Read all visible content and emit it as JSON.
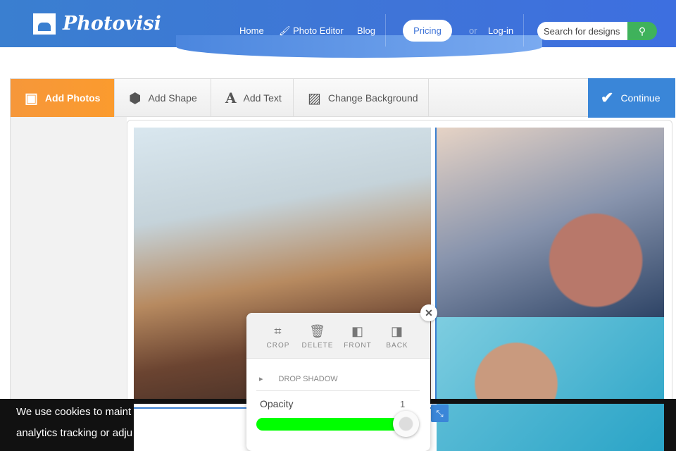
{
  "header": {
    "brand": "Photovisi",
    "nav": [
      "Home",
      "Photo Editor",
      "Blog"
    ],
    "pricing": "Pricing",
    "or": "or",
    "login": "Log-in",
    "search_placeholder": "Search for designs"
  },
  "toolbar": {
    "add_photos": "Add Photos",
    "add_shape": "Add Shape",
    "add_text": "Add Text",
    "change_background": "Change Background",
    "continue": "Continue"
  },
  "panel": {
    "crop": "CROP",
    "delete": "DELETE",
    "front": "FRONT",
    "back": "BACK",
    "drop_shadow": "DROP SHADOW",
    "opacity_label": "Opacity",
    "opacity_value": "1"
  },
  "cookie": {
    "line1": "We use cookies to maint",
    "line2": "analytics tracking or adju"
  },
  "colors": {
    "header": "#3a7fd0",
    "add_photos": "#f6973a",
    "continue": "#3a86d8",
    "slider": "#00ff00",
    "search_button": "#3fb25b"
  }
}
